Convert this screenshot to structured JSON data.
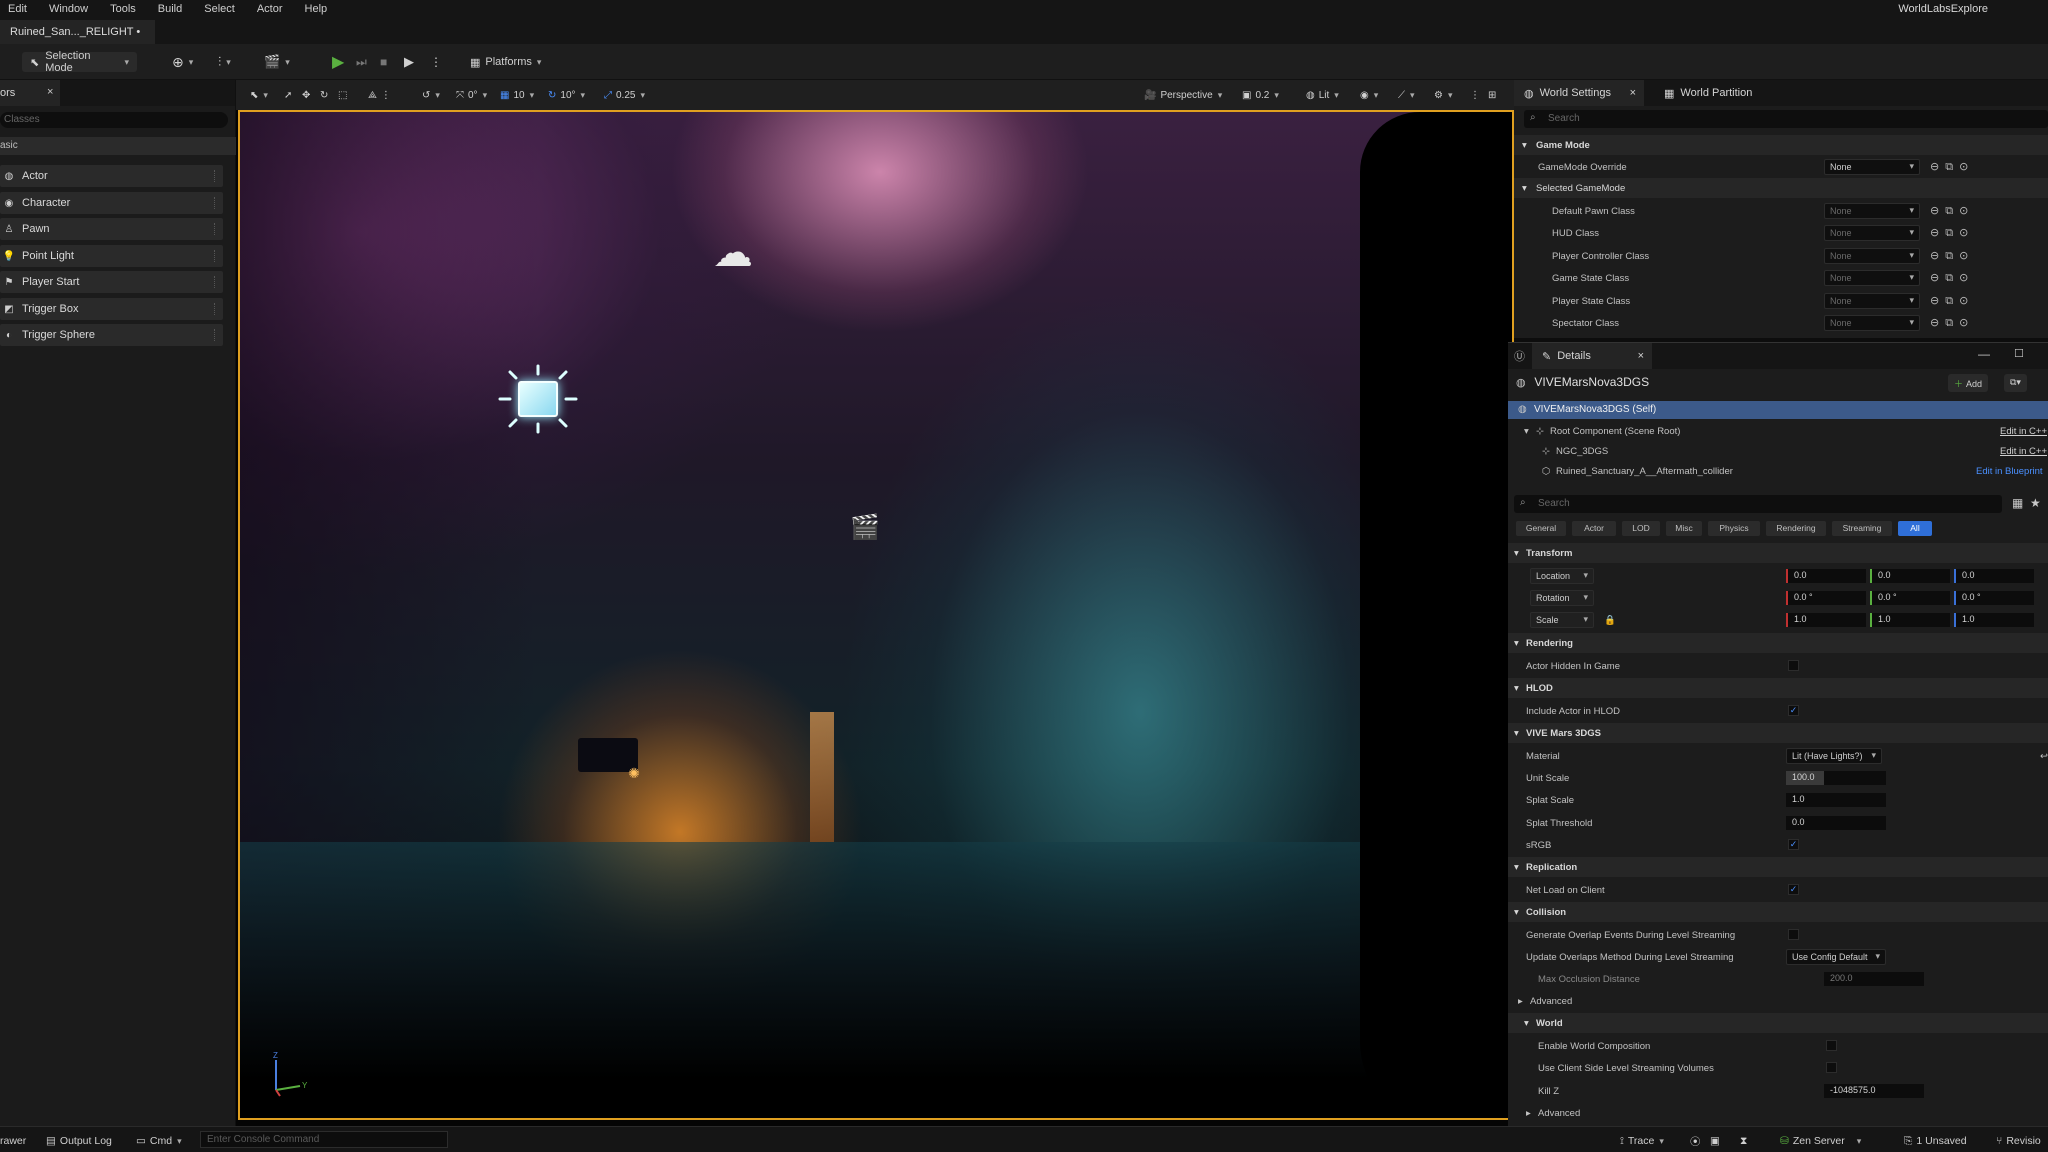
{
  "menubar": {
    "items": [
      "Edit",
      "Window",
      "Tools",
      "Build",
      "Select",
      "Actor",
      "Help"
    ],
    "app_name": "WorldLabsExplore"
  },
  "document_tab": {
    "label": "Ruined_San..._RELIGHT •"
  },
  "toolbar": {
    "mode_label": "Selection Mode",
    "platforms_label": "Platforms"
  },
  "left_panel": {
    "tab_label": "ors",
    "close": "×",
    "search_placeholder": "Classes",
    "category": "asic",
    "items": [
      {
        "label": "Actor",
        "icon": "actor-icon"
      },
      {
        "label": "Character",
        "icon": "character-icon"
      },
      {
        "label": "Pawn",
        "icon": "pawn-icon"
      },
      {
        "label": "Point Light",
        "icon": "point-light-icon"
      },
      {
        "label": "Player Start",
        "icon": "player-start-icon"
      },
      {
        "label": "Trigger Box",
        "icon": "trigger-box-icon"
      },
      {
        "label": "Trigger Sphere",
        "icon": "trigger-sphere-icon"
      }
    ]
  },
  "viewport_toolbar": {
    "rotate_snap": "0°",
    "grid_snap": "10",
    "angle_snap": "10°",
    "scale_snap": "0.25",
    "view_mode": "Perspective",
    "camera_speed": "0.2",
    "lighting": "Lit"
  },
  "world_settings": {
    "tab_label": "World Settings",
    "tab2_label": "World Partition",
    "close": "×",
    "search_placeholder": "Search",
    "game_mode_header": "Game Mode",
    "gamemode_override_label": "GameMode Override",
    "gamemode_override_value": "None",
    "selected_gamemode_header": "Selected GameMode",
    "class_rows": [
      {
        "label": "Default Pawn Class",
        "value": "None"
      },
      {
        "label": "HUD Class",
        "value": "None"
      },
      {
        "label": "Player Controller Class",
        "value": "None"
      },
      {
        "label": "Game State Class",
        "value": "None"
      },
      {
        "label": "Player State Class",
        "value": "None"
      },
      {
        "label": "Spectator Class",
        "value": "None"
      }
    ]
  },
  "details": {
    "tab_label": "Details",
    "close": "×",
    "actor_name": "VIVEMarsNova3DGS",
    "add_label": "Add",
    "tree": [
      {
        "label": "VIVEMarsNova3DGS (Self)",
        "action": ""
      },
      {
        "label": "Root Component (Scene Root)",
        "action": "Edit in C++"
      },
      {
        "label": "NGC_3DGS",
        "action": "Edit in C++"
      },
      {
        "label": "Ruined_Sanctuary_A__Aftermath_collider",
        "action": "Edit in Blueprint"
      }
    ],
    "search_placeholder": "Search",
    "filters": [
      "General",
      "Actor",
      "LOD",
      "Misc",
      "Physics",
      "Rendering",
      "Streaming",
      "All"
    ],
    "active_filter": "All",
    "transform_header": "Transform",
    "location_label": "Location",
    "location": [
      "0.0",
      "0.0",
      "0.0"
    ],
    "rotation_label": "Rotation",
    "rotation": [
      "0.0 °",
      "0.0 °",
      "0.0 °"
    ],
    "scale_label": "Scale",
    "scale": [
      "1.0",
      "1.0",
      "1.0"
    ],
    "rendering_header": "Rendering",
    "actor_hidden_label": "Actor Hidden In Game",
    "actor_hidden": false,
    "hlod_header": "HLOD",
    "include_hlod_label": "Include Actor in HLOD",
    "include_hlod": true,
    "vive_header": "VIVE Mars 3DGS",
    "material_label": "Material",
    "material_value": "Lit (Have Lights?)",
    "unit_scale_label": "Unit Scale",
    "unit_scale_value": "100.0",
    "splat_scale_label": "Splat Scale",
    "splat_scale_value": "1.0",
    "splat_threshold_label": "Splat Threshold",
    "splat_threshold_value": "0.0",
    "srgb_label": "sRGB",
    "srgb": true,
    "replication_header": "Replication",
    "net_load_label": "Net Load on Client",
    "net_load": true,
    "collision_header": "Collision",
    "gen_overlap_label": "Generate Overlap Events During Level Streaming",
    "gen_overlap": false,
    "update_overlap_label": "Update Overlaps Method During Level Streaming",
    "update_overlap_value": "Use Config Default",
    "max_occlusion_label": "Max Occlusion Distance",
    "max_occlusion_value": "200.0",
    "advanced_label": "Advanced",
    "world_header": "World",
    "enable_world_comp_label": "Enable World Composition",
    "use_client_streaming_label": "Use Client Side Level Streaming Volumes",
    "kill_z_label": "Kill Z",
    "kill_z_value": "-1048575.0",
    "advanced2_label": "Advanced"
  },
  "statusbar": {
    "drawer_label": "rawer",
    "output_log_label": "Output Log",
    "cmd_label": "Cmd",
    "console_placeholder": "Enter Console Command",
    "trace_label": "Trace",
    "zen_server_label": "Zen Server",
    "unsaved_label": "1 Unsaved",
    "revision_label": "Revisio"
  },
  "colors": {
    "accent_blue": "#2f6fd8",
    "viewport_border": "#e0a020",
    "play_green": "#5ab040"
  }
}
